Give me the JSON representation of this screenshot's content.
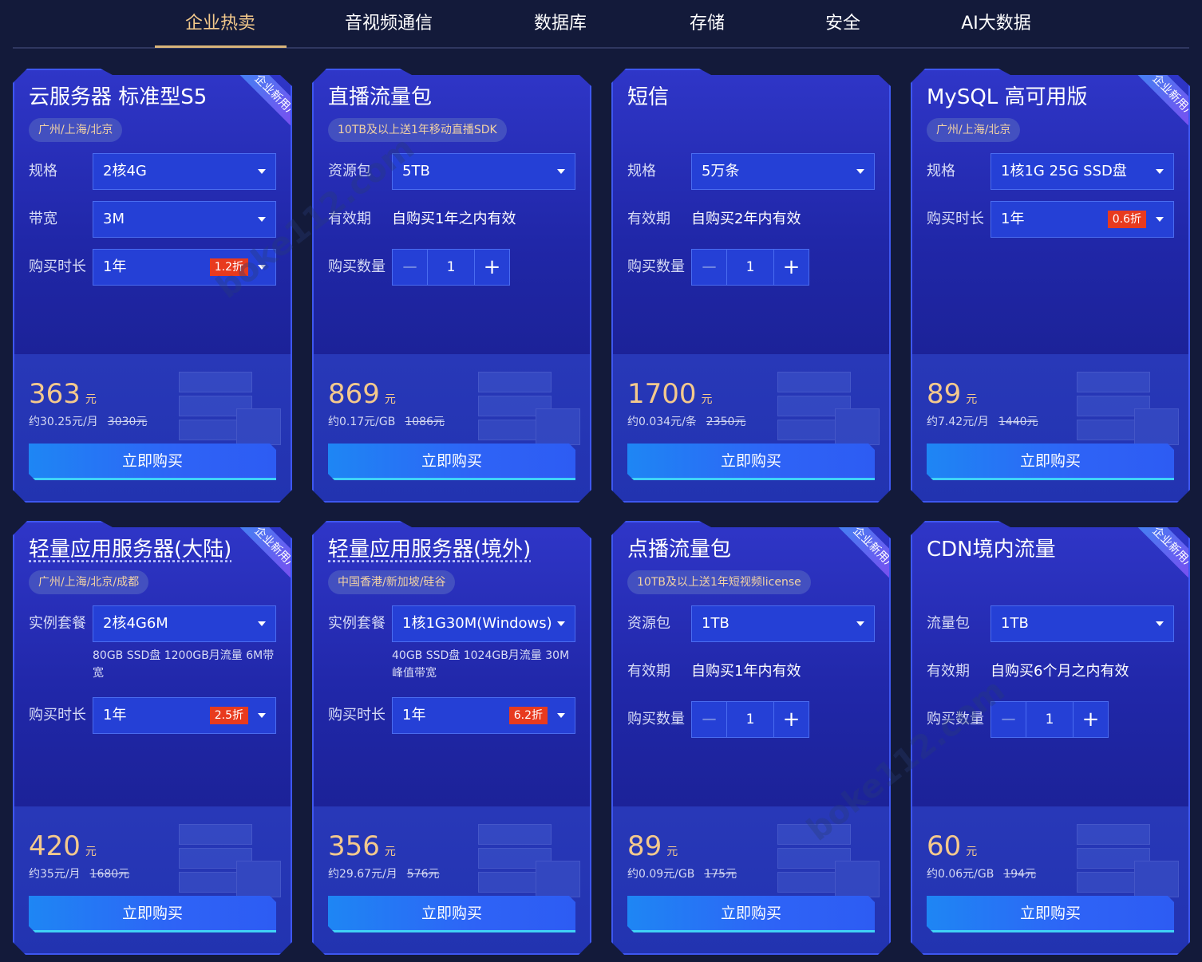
{
  "tabs": [
    "企业热卖",
    "音视频通信",
    "数据库",
    "存储",
    "安全",
    "AI大数据"
  ],
  "active_tab": "企业热卖",
  "ribbon_label": "企业新用户",
  "buy_label": "立即购买",
  "watermark": "boke112.com",
  "cards": [
    {
      "title": "云服务器 标准型S5",
      "region": "广州/上海/北京",
      "new_user": true,
      "rows": [
        {
          "label": "规格",
          "type": "select",
          "value": "2核4G"
        },
        {
          "label": "带宽",
          "type": "select",
          "value": "3M"
        },
        {
          "label": "购买时长",
          "type": "select",
          "value": "1年",
          "discount": "1.2折"
        }
      ],
      "price": "363",
      "price_unit": "元",
      "unit_price": "约30.25元/月",
      "original_price": "3030元"
    },
    {
      "title": "直播流量包",
      "region": "10TB及以上送1年移动直播SDK",
      "new_user": false,
      "rows": [
        {
          "label": "资源包",
          "type": "select",
          "value": "5TB"
        },
        {
          "label": "有效期",
          "type": "text",
          "value": "自购买1年之内有效"
        },
        {
          "label": "购买数量",
          "type": "stepper",
          "value": "1"
        }
      ],
      "price": "869",
      "price_unit": "元",
      "unit_price": "约0.17元/GB",
      "original_price": "1086元"
    },
    {
      "title": "短信",
      "region": "",
      "new_user": false,
      "rows": [
        {
          "label": "规格",
          "type": "select",
          "value": "5万条"
        },
        {
          "label": "有效期",
          "type": "text",
          "value": "自购买2年内有效"
        },
        {
          "label": "购买数量",
          "type": "stepper",
          "value": "1"
        }
      ],
      "price": "1700",
      "price_unit": "元",
      "unit_price": "约0.034元/条",
      "original_price": "2350元"
    },
    {
      "title": "MySQL 高可用版",
      "region": "广州/上海/北京",
      "new_user": true,
      "rows": [
        {
          "label": "规格",
          "type": "select",
          "value": "1核1G 25G SSD盘"
        },
        {
          "label": "购买时长",
          "type": "select",
          "value": "1年",
          "discount": "0.6折"
        }
      ],
      "price": "89",
      "price_unit": "元",
      "unit_price": "约7.42元/月",
      "original_price": "1440元"
    },
    {
      "title": "轻量应用服务器(大陆)",
      "region": "广州/上海/北京/成都",
      "new_user": true,
      "rows": [
        {
          "label": "实例套餐",
          "type": "select",
          "value": "2核4G6M",
          "note": "80GB SSD盘 1200GB月流量 6M带宽"
        },
        {
          "label": "购买时长",
          "type": "select",
          "value": "1年",
          "discount": "2.5折"
        }
      ],
      "price": "420",
      "price_unit": "元",
      "unit_price": "约35元/月",
      "original_price": "1680元"
    },
    {
      "title": "轻量应用服务器(境外)",
      "region": "中国香港/新加坡/硅谷",
      "new_user": false,
      "rows": [
        {
          "label": "实例套餐",
          "type": "select",
          "value": "1核1G30M(Windows)",
          "note": "40GB SSD盘 1024GB月流量 30M峰值带宽"
        },
        {
          "label": "购买时长",
          "type": "select",
          "value": "1年",
          "discount": "6.2折"
        }
      ],
      "price": "356",
      "price_unit": "元",
      "unit_price": "约29.67元/月",
      "original_price": "576元"
    },
    {
      "title": "点播流量包",
      "region": "10TB及以上送1年短视频license",
      "new_user": true,
      "rows": [
        {
          "label": "资源包",
          "type": "select",
          "value": "1TB"
        },
        {
          "label": "有效期",
          "type": "text",
          "value": "自购买1年内有效"
        },
        {
          "label": "购买数量",
          "type": "stepper",
          "value": "1"
        }
      ],
      "price": "89",
      "price_unit": "元",
      "unit_price": "约0.09元/GB",
      "original_price": "175元"
    },
    {
      "title": "CDN境内流量",
      "region": "",
      "new_user": true,
      "rows": [
        {
          "label": "流量包",
          "type": "select",
          "value": "1TB"
        },
        {
          "label": "有效期",
          "type": "text",
          "value": "自购买6个月之内有效"
        },
        {
          "label": "购买数量",
          "type": "stepper",
          "value": "1"
        }
      ],
      "price": "60",
      "price_unit": "元",
      "unit_price": "约0.06元/GB",
      "original_price": "194元"
    }
  ]
}
